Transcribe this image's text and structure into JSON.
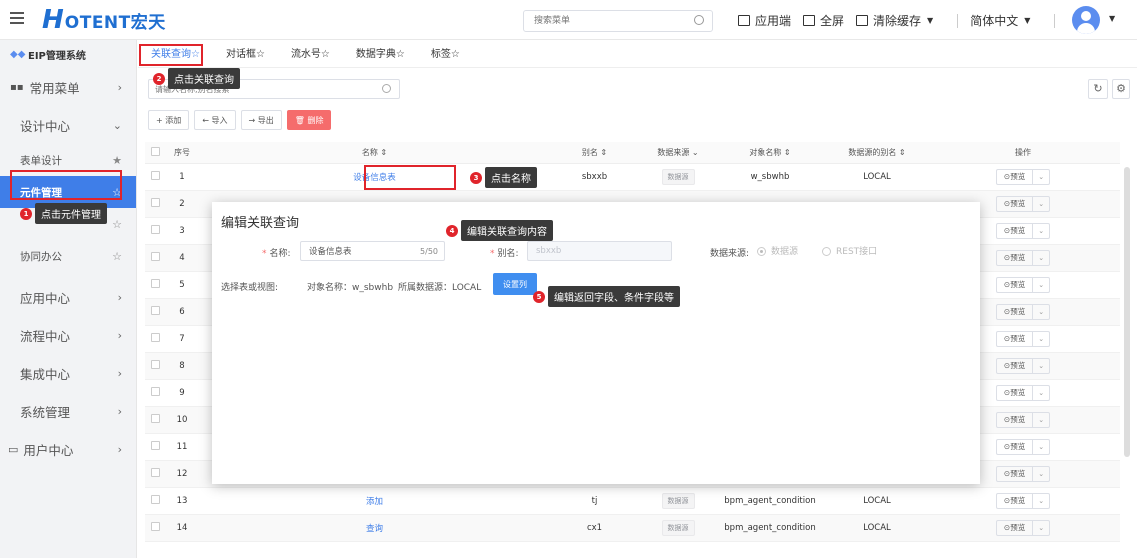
{
  "topbar": {
    "logo_text": "OTENT宏天",
    "logo_letter": "H",
    "search_placeholder": "搜索菜单",
    "app_end_label": "应用端",
    "fullscreen_label": "全屏",
    "clear_cache_label": "清除缓存",
    "language_label": "简体中文"
  },
  "sidebar": {
    "system_name": "EIP管理系统",
    "items": [
      {
        "label": "常用菜单"
      },
      {
        "label": "设计中心"
      }
    ],
    "sub_items": [
      {
        "label": "表单设计"
      },
      {
        "label": "元件管理"
      },
      {
        "label": "协同办公"
      }
    ],
    "bottom_items": [
      {
        "label": "应用中心"
      },
      {
        "label": "流程中心"
      },
      {
        "label": "集成中心"
      },
      {
        "label": "系统管理"
      },
      {
        "label": "用户中心"
      }
    ]
  },
  "tabs": [
    {
      "label": "关联查询☆"
    },
    {
      "label": "对话框☆"
    },
    {
      "label": "流水号☆"
    },
    {
      "label": "数据字典☆"
    },
    {
      "label": "标签☆"
    }
  ],
  "toolbar": {
    "search_placeholder": "请输入名称,别名搜索",
    "add_label": "+ 添加",
    "import_label": "← 导入",
    "export_label": "→ 导出",
    "delete_label": "🗑 删除"
  },
  "table": {
    "headers": {
      "index": "序号",
      "name": "名称 ⇕",
      "alias": "别名 ⇕",
      "source": "数据来源 ⌄",
      "object": "对象名称 ⇕",
      "ds_alias": "数据源的别名 ⇕",
      "ops": "操作"
    },
    "preview_label": "⊙预览",
    "rows": [
      {
        "index": "1",
        "name": "设备信息表",
        "alias": "sbxxb",
        "source": "数据源",
        "object": "w_sbwhb",
        "ds_alias": "LOCAL"
      },
      {
        "index": "2",
        "name": "",
        "alias": "",
        "source": "",
        "object": "",
        "ds_alias": ""
      },
      {
        "index": "3",
        "name": "",
        "alias": "",
        "source": "",
        "object": "",
        "ds_alias": ""
      },
      {
        "index": "4",
        "name": "",
        "alias": "",
        "source": "",
        "object": "",
        "ds_alias": ""
      },
      {
        "index": "5",
        "name": "",
        "alias": "",
        "source": "",
        "object": "",
        "ds_alias": ""
      },
      {
        "index": "6",
        "name": "",
        "alias": "",
        "source": "",
        "object": "",
        "ds_alias": ""
      },
      {
        "index": "7",
        "name": "",
        "alias": "",
        "source": "",
        "object": "",
        "ds_alias": ""
      },
      {
        "index": "8",
        "name": "",
        "alias": "",
        "source": "",
        "object": "",
        "ds_alias": ""
      },
      {
        "index": "9",
        "name": "",
        "alias": "",
        "source": "",
        "object": "",
        "ds_alias": ""
      },
      {
        "index": "10",
        "name": "",
        "alias": "",
        "source": "",
        "object": "",
        "ds_alias": ""
      },
      {
        "index": "11",
        "name": "",
        "alias": "",
        "source": "",
        "object": "",
        "ds_alias": ""
      },
      {
        "index": "12",
        "name": "",
        "alias": "",
        "source": "",
        "object": "",
        "ds_alias": ""
      },
      {
        "index": "13",
        "name": "添加",
        "alias": "tj",
        "source": "数据源",
        "object": "bpm_agent_condition",
        "ds_alias": "LOCAL"
      },
      {
        "index": "14",
        "name": "查询",
        "alias": "cx1",
        "source": "数据源",
        "object": "bpm_agent_condition",
        "ds_alias": "LOCAL"
      }
    ]
  },
  "dialog": {
    "title": "编辑关联查询",
    "name_label": "名称:",
    "name_value": "设备信息表",
    "name_count": "5/50",
    "alias_label": "别名:",
    "alias_value": "sbxxb",
    "source_label": "数据来源:",
    "source_opt1": "数据源",
    "source_opt2": "REST接口",
    "table_label": "选择表或视图:",
    "object_text": "对象名称：w_sbwhb",
    "ds_text": "所属数据源：LOCAL",
    "set_col_label": "设置列"
  },
  "callouts": [
    {
      "num": "1",
      "text": "点击元件管理"
    },
    {
      "num": "2",
      "text": "点击关联查询"
    },
    {
      "num": "3",
      "text": "点击名称"
    },
    {
      "num": "4",
      "text": "编辑关联查询内容"
    },
    {
      "num": "5",
      "text": "编辑返回字段、条件字段等"
    }
  ],
  "colors": {
    "primary": "#3f7ee8",
    "highlight": "#e0242b",
    "danger": "#f56c6c"
  }
}
